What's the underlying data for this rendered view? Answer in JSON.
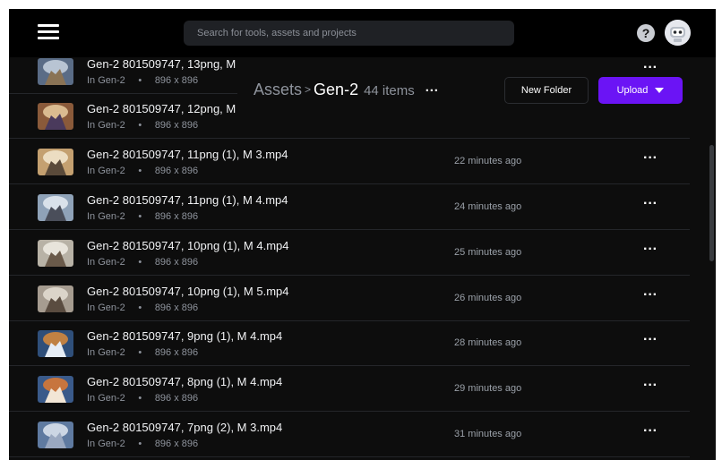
{
  "topbar": {
    "search_placeholder": "Search for tools, assets and projects"
  },
  "header": {
    "breadcrumb_root": "Assets",
    "breadcrumb_sep": ">",
    "breadcrumb_current": "Gen-2",
    "item_count": "44 items",
    "menu": "···"
  },
  "actions": {
    "new_folder": "New Folder",
    "upload": "Upload"
  },
  "assets": [
    {
      "title": "Gen-2 801509747, 13png, M",
      "folder": "In Gen-2",
      "dims": "896 x 896",
      "time": ""
    },
    {
      "title": "Gen-2 801509747, 12png, M",
      "folder": "In Gen-2",
      "dims": "896 x 896",
      "time": ""
    },
    {
      "title": "Gen-2 801509747, 11png (1), M 3.mp4",
      "folder": "In Gen-2",
      "dims": "896 x 896",
      "time": "22 minutes ago"
    },
    {
      "title": "Gen-2 801509747, 11png (1), M 4.mp4",
      "folder": "In Gen-2",
      "dims": "896 x 896",
      "time": "24 minutes ago"
    },
    {
      "title": "Gen-2 801509747, 10png (1), M 4.mp4",
      "folder": "In Gen-2",
      "dims": "896 x 896",
      "time": "25 minutes ago"
    },
    {
      "title": "Gen-2 801509747, 10png (1), M 5.mp4",
      "folder": "In Gen-2",
      "dims": "896 x 896",
      "time": "26 minutes ago"
    },
    {
      "title": "Gen-2 801509747, 9png (1), M 4.mp4",
      "folder": "In Gen-2",
      "dims": "896 x 896",
      "time": "28 minutes ago"
    },
    {
      "title": "Gen-2 801509747, 8png (1), M 4.mp4",
      "folder": "In Gen-2",
      "dims": "896 x 896",
      "time": "29 minutes ago"
    },
    {
      "title": "Gen-2 801509747, 7png (2), M 3.mp4",
      "folder": "In Gen-2",
      "dims": "896 x 896",
      "time": "31 minutes ago"
    }
  ],
  "colors": {
    "background": "#0d0d0d",
    "accent": "#6b14f5"
  }
}
